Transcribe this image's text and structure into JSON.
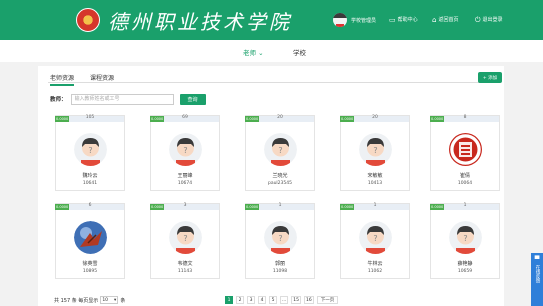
{
  "header": {
    "school_name": "德州职业技术学院",
    "user_label": "学校管理员",
    "links": [
      {
        "label": "帮助中心",
        "icon": "help-icon"
      },
      {
        "label": "返回首页",
        "icon": "home-icon"
      },
      {
        "label": "退出登录",
        "icon": "logout-icon"
      }
    ],
    "colors": {
      "header_bg": "#1aa06b",
      "accent": "#1aa06b"
    }
  },
  "top_tabs": [
    {
      "label": "老师 ⌄",
      "active": true
    },
    {
      "label": "学校",
      "active": false
    }
  ],
  "sub_tabs": [
    {
      "label": "老师资源",
      "active": true
    },
    {
      "label": "课程资源",
      "active": false
    }
  ],
  "add_button": {
    "label": "+ 添加"
  },
  "search": {
    "label": "教师：",
    "placeholder": "输入教师姓名或工号",
    "button": "查询"
  },
  "cards": [
    {
      "badge": "0.0000",
      "count": "105",
      "name": "魏玲云",
      "id": "10641",
      "avatar": "default-avatar"
    },
    {
      "badge": "0.0000",
      "count": "69",
      "name": "王丽峰",
      "id": "10674",
      "avatar": "default-avatar"
    },
    {
      "badge": "0.0000",
      "count": "20",
      "name": "兰晓光",
      "id": "paul23545",
      "avatar": "default-avatar"
    },
    {
      "badge": "0.0000",
      "count": "20",
      "name": "宋敏敏",
      "id": "10413",
      "avatar": "default-avatar"
    },
    {
      "badge": "0.0000",
      "count": "8",
      "name": "崔倩",
      "id": "10064",
      "avatar": "fu-seal"
    },
    {
      "badge": "0.0000",
      "count": "6",
      "name": "徐英雪",
      "id": "10895",
      "avatar": "photo-avatar"
    },
    {
      "badge": "0.0000",
      "count": "3",
      "name": "韦德文",
      "id": "11143",
      "avatar": "default-avatar"
    },
    {
      "badge": "0.0000",
      "count": "1",
      "name": "郭丽",
      "id": "11098",
      "avatar": "default-avatar"
    },
    {
      "badge": "0.0000",
      "count": "1",
      "name": "牛林云",
      "id": "11062",
      "avatar": "default-avatar"
    },
    {
      "badge": "0.0000",
      "count": "1",
      "name": "薛艳静",
      "id": "10659",
      "avatar": "default-avatar"
    }
  ],
  "pagination": {
    "total_text": "共 157 条 每页显示",
    "page_size": "10",
    "unit": "条",
    "pages": [
      "1",
      "2",
      "3",
      "4",
      "5",
      "...",
      "15",
      "16"
    ],
    "current_page": "1",
    "next_label": "下一页"
  },
  "feedback": {
    "label": "在线反馈"
  }
}
